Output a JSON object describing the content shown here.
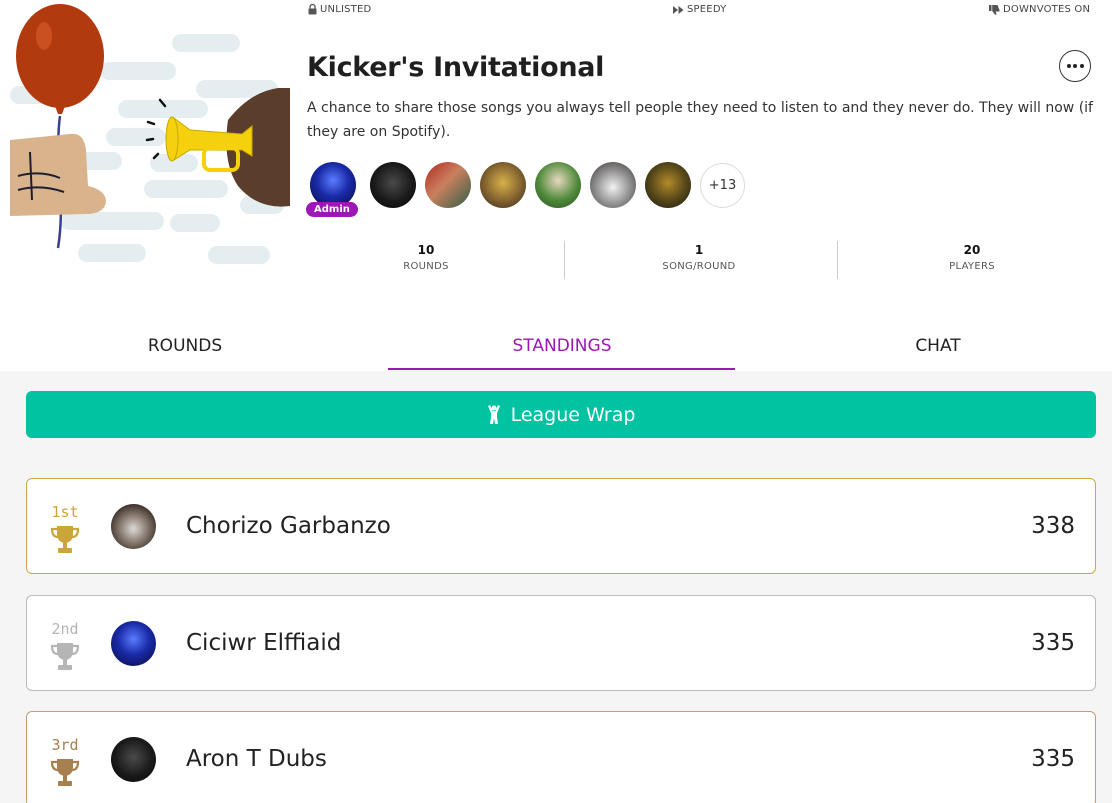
{
  "league": {
    "visibility": "UNLISTED",
    "speed": "SPEEDY",
    "downvotes": "DOWNVOTES ON",
    "title": "Kicker's Invitational",
    "description": "A chance to share those songs you always tell people they need to listen to and they never do. They will now (if they are on Spotify).",
    "admin_badge": "Admin",
    "more_players": "+13"
  },
  "stats": [
    {
      "value": "10",
      "label": "ROUNDS"
    },
    {
      "value": "1",
      "label": "SONG/ROUND"
    },
    {
      "value": "20",
      "label": "PLAYERS"
    }
  ],
  "tabs": [
    {
      "label": "ROUNDS"
    },
    {
      "label": "STANDINGS"
    },
    {
      "label": "CHAT"
    }
  ],
  "wrap_button": "League Wrap",
  "standings": [
    {
      "rank": "1st",
      "name": "Chorizo Garbanzo",
      "score": "338"
    },
    {
      "rank": "2nd",
      "name": "Ciciwr Elffiaid",
      "score": "335"
    },
    {
      "rank": "3rd",
      "name": "Aron T Dubs",
      "score": "335"
    }
  ],
  "colors": {
    "accent": "#9c17b5",
    "wrap_button": "#01c2a1",
    "gold": "#c9a53a",
    "silver": "#b5b5b5",
    "bronze": "#a7804f"
  }
}
